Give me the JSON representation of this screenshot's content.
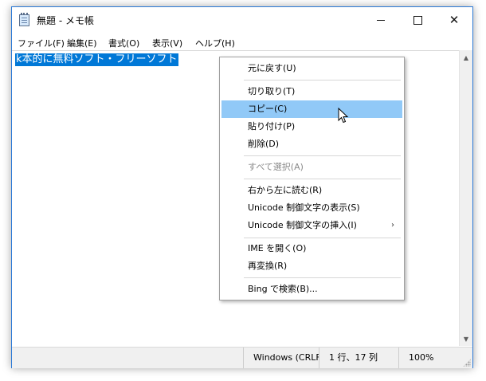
{
  "window": {
    "title": "無題 - メモ帳"
  },
  "menubar": {
    "items": [
      "ファイル(F)",
      "編集(E)",
      "書式(O)",
      "表示(V)",
      "ヘルプ(H)"
    ]
  },
  "editor": {
    "selected_text": "k本的に無料ソフト・フリーソフト"
  },
  "statusbar": {
    "encoding": "Windows (CRLF)",
    "position": "1 行、17 列",
    "zoom": "100%"
  },
  "context_menu": {
    "undo": "元に戻す(U)",
    "cut": "切り取り(T)",
    "copy": "コピー(C)",
    "paste": "貼り付け(P)",
    "delete": "削除(D)",
    "select_all": "すべて選択(A)",
    "rtl": "右から左に読む(R)",
    "show_unicode": "Unicode 制御文字の表示(S)",
    "insert_unicode": "Unicode 制御文字の挿入(I)",
    "open_ime": "IME を開く(O)",
    "reconvert": "再変換(R)",
    "bing_search": "Bing で検索(B)..."
  },
  "colors": {
    "selection": "#0078d7",
    "menu_highlight": "#91c9f7",
    "window_border": "#2b79d6"
  }
}
